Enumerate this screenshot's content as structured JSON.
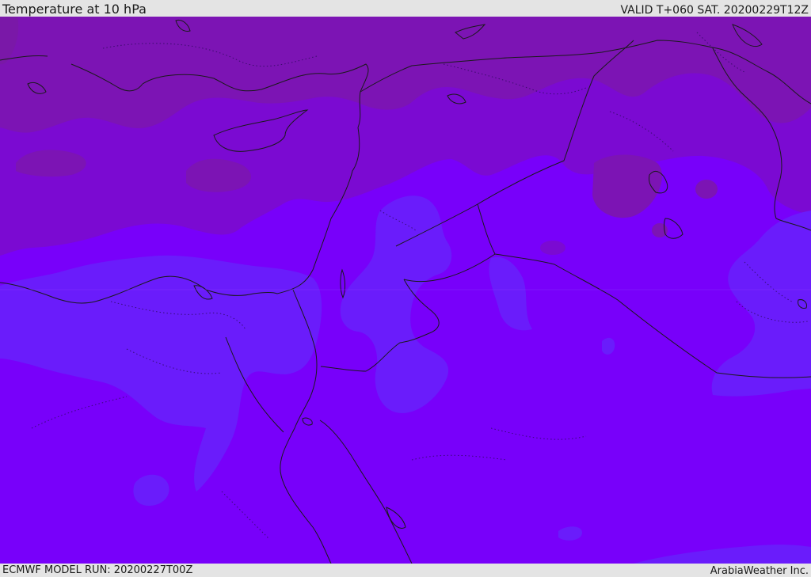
{
  "header": {
    "title": "Temperature at 10 hPa",
    "valid": "VALID T+060 SAT. 20200229T12Z"
  },
  "footer": {
    "model_run": "ECMWF MODEL RUN: 20200227T00Z",
    "credit": "ArabiaWeather Inc."
  },
  "colors": {
    "warm_band": "#7c14b4",
    "mid_band": "#7b0ad2",
    "base_band": "#7800fa",
    "cool_band": "#6a1cfb",
    "coast_line": "#1a1a1a"
  }
}
